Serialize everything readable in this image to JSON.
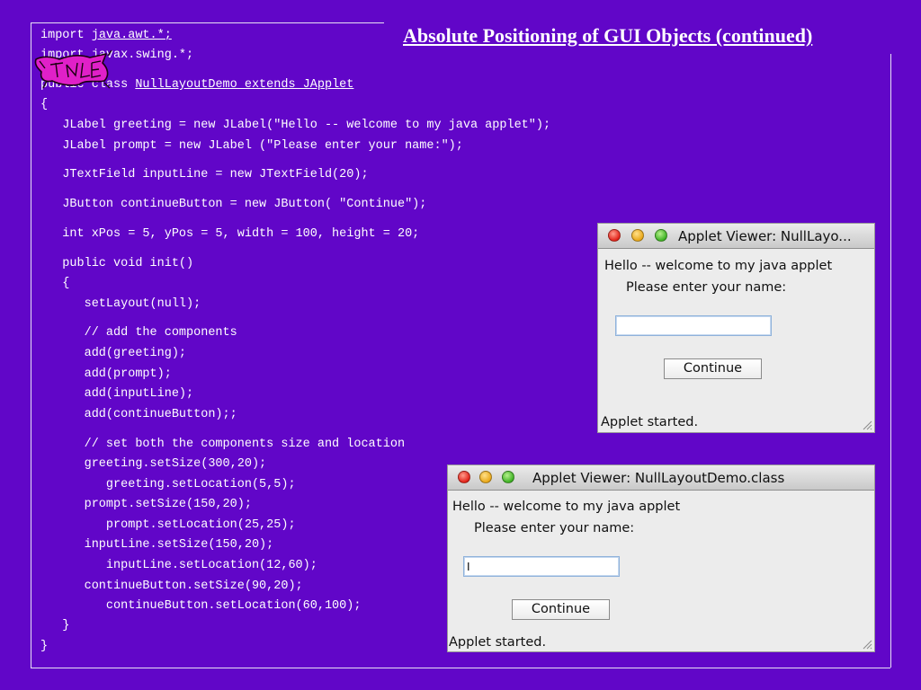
{
  "slide": {
    "title": "Absolute Positioning of GUI Objects (continued)"
  },
  "code": {
    "lines": [
      [
        "import ",
        "java.awt.*;"
      ],
      [
        "import javax.swing.*;"
      ],
      [
        "public class ",
        "NullLayoutDemo extends JApplet"
      ],
      [
        "{"
      ],
      [
        "   JLabel greeting = new JLabel(\"Hello -- welcome to my java applet\");"
      ],
      [
        "   JLabel prompt = new JLabel (\"Please enter your name:\");"
      ],
      [
        "   JTextField inputLine = new JTextField(20);"
      ],
      [
        "   JButton continueButton = new JButton( \"Continue\");"
      ],
      [
        "   int xPos = 5, yPos = 5, width = 100, height = 20;"
      ],
      [
        "   public void init()"
      ],
      [
        "   {"
      ],
      [
        "      setLayout(null);"
      ],
      [
        "      // add the components"
      ],
      [
        "      add(greeting);"
      ],
      [
        "      add(prompt);"
      ],
      [
        "      add(inputLine);"
      ],
      [
        "      add(continueButton);;"
      ],
      [
        "      // set both the components size and location"
      ],
      [
        "      greeting.setSize(300,20);"
      ],
      [
        "         greeting.setLocation(5,5);"
      ],
      [
        "      prompt.setSize(150,20);"
      ],
      [
        "         prompt.setLocation(25,25);"
      ],
      [
        "      inputLine.setSize(150,20);"
      ],
      [
        "         inputLine.setLocation(12,60);"
      ],
      [
        "      continueButton.setSize(90,20);"
      ],
      [
        "         continueButton.setLocation(60,100);"
      ],
      [
        "   }"
      ],
      [
        "}"
      ]
    ]
  },
  "applet1": {
    "title": "Applet Viewer: NullLayo...",
    "greeting": "Hello -- welcome to my java applet",
    "prompt": "Please enter your name:",
    "input_value": "",
    "button": "Continue",
    "status": "Applet started."
  },
  "applet2": {
    "title": "Applet Viewer: NullLayoutDemo.class",
    "greeting": "Hello -- welcome to my java applet",
    "prompt": "Please enter your name:",
    "input_value": "I",
    "button": "Continue",
    "status": "Applet started."
  },
  "colors": {
    "background": "#6106c8",
    "text": "#ffffff",
    "logo": "#e020c8"
  },
  "icons": [
    "logo-icon",
    "close-icon",
    "minimize-icon",
    "zoom-icon",
    "resize-grip-icon"
  ]
}
